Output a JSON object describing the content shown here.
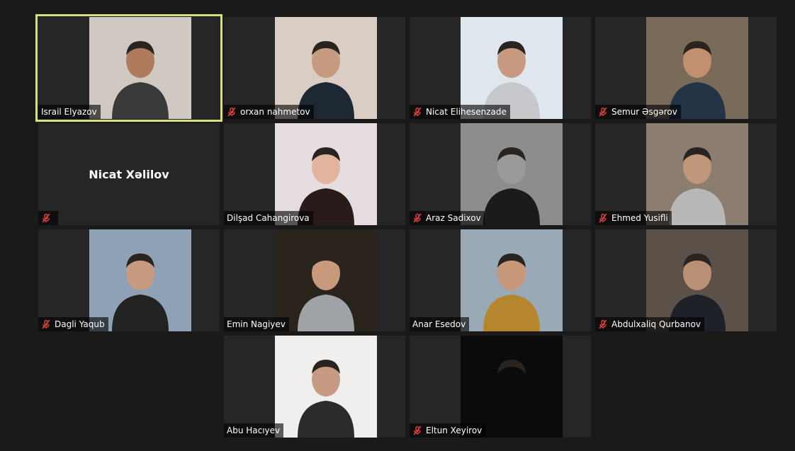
{
  "participants": [
    {
      "name": "Israil Elyazov",
      "muted": false,
      "active": true,
      "video": true,
      "bg": "#cfc9c2",
      "fg": "#3a3a3a",
      "skin": "#b07a5c"
    },
    {
      "name": "orxan nahmetov",
      "muted": true,
      "active": false,
      "video": true,
      "bg": "#d9cdc4",
      "fg": "#1e2833",
      "skin": "#c79a82"
    },
    {
      "name": "Nicat Elihesenzade",
      "muted": true,
      "active": false,
      "video": true,
      "bg": "#dfe6ee",
      "fg": "#c7c8cc",
      "skin": "#c89a80"
    },
    {
      "name": "Semur Əsgərov",
      "muted": true,
      "active": false,
      "video": true,
      "bg": "#7a6a5a",
      "fg": "#243447",
      "skin": "#c1906f"
    },
    {
      "name": "Nicat Xəlilov",
      "muted": true,
      "active": false,
      "video": false
    },
    {
      "name": "Dilşad Cahangirova",
      "muted": false,
      "active": false,
      "video": true,
      "bg": "#e6dde0",
      "fg": "#2a1b1b",
      "skin": "#e2b49d"
    },
    {
      "name": "Araz Sadixov",
      "muted": true,
      "active": false,
      "video": true,
      "bg": "#8d8d8d",
      "fg": "#1b1b1b",
      "skin": "#9a9a9a"
    },
    {
      "name": "Ehmed Yusifli",
      "muted": true,
      "active": false,
      "video": true,
      "bg": "#8b7d70",
      "fg": "#b8b8b8",
      "skin": "#c0977a"
    },
    {
      "name": "Dagli Yaqub",
      "muted": true,
      "active": false,
      "video": true,
      "bg": "#8fa1b5",
      "fg": "#222222",
      "skin": "#c79a82"
    },
    {
      "name": "Emin Nagiyev",
      "muted": false,
      "active": false,
      "video": true,
      "bg": "#2a241d",
      "fg": "#9fa3a8",
      "skin": "#c79a7c"
    },
    {
      "name": "Anar Esedov",
      "muted": false,
      "active": false,
      "video": true,
      "bg": "#9aa9b6",
      "fg": "#b5862e",
      "skin": "#c8987a"
    },
    {
      "name": "Abdulxaliq Qurbanov",
      "muted": true,
      "active": false,
      "video": true,
      "bg": "#5b5148",
      "fg": "#1d2128",
      "skin": "#b98f76"
    },
    {
      "name": "Abu Hacıyev",
      "muted": false,
      "active": false,
      "video": true,
      "bg": "#f1efee",
      "fg": "#2b2b2b",
      "skin": "#c79b83"
    },
    {
      "name": "Eltun Xeyirov",
      "muted": true,
      "active": false,
      "video": true,
      "bg": "#0b0b0b",
      "fg": "#0b0b0b",
      "skin": "#0b0b0b"
    }
  ]
}
